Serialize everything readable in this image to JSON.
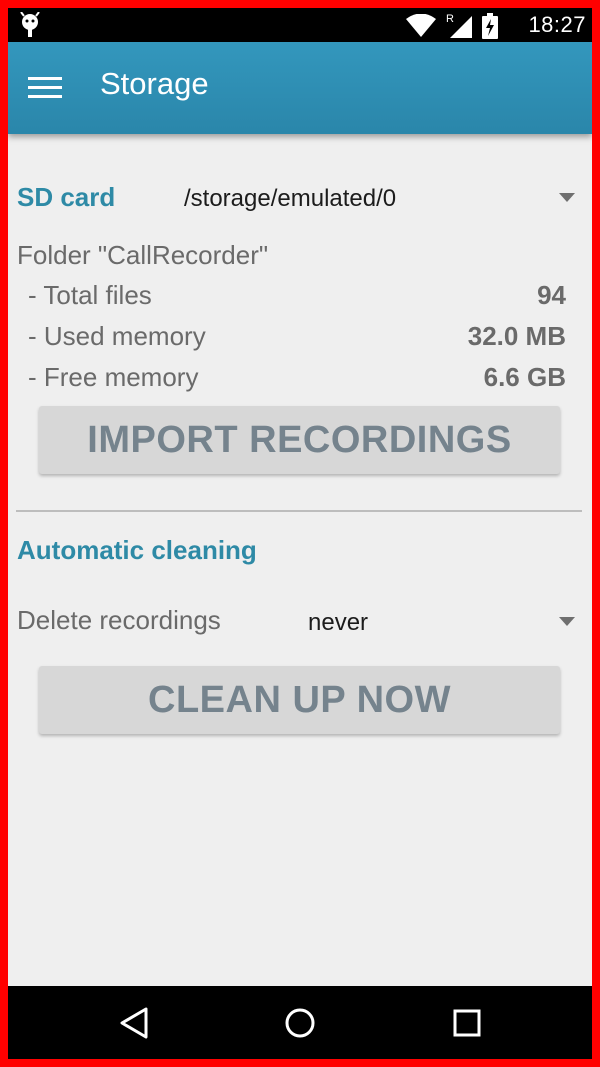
{
  "status_bar": {
    "time": "18:27",
    "left_icon": "android-debug-icon",
    "signal_roaming": "R"
  },
  "toolbar": {
    "title": "Storage",
    "menu_icon": "hamburger-menu-icon"
  },
  "storage": {
    "section_label": "SD card",
    "path_value": "/storage/emulated/0",
    "folder_label": "Folder \"CallRecorder\"",
    "stats": [
      {
        "label": " - Total files",
        "value": "94"
      },
      {
        "label": " - Used memory",
        "value": "32.0 MB"
      },
      {
        "label": " - Free memory",
        "value": "6.6 GB"
      }
    ],
    "import_button": "IMPORT RECORDINGS"
  },
  "cleaning": {
    "section_label": "Automatic cleaning",
    "delete_label": "Delete recordings",
    "delete_value": "never",
    "clean_button": "CLEAN UP NOW"
  },
  "colors": {
    "accent": "#2e8aa6",
    "toolbar": "#3397bd",
    "frame_border": "#ff0000",
    "background": "#efefef",
    "button_bg": "#d7d7d7",
    "button_text": "#75838d"
  },
  "nav_bar": {
    "back_icon": "back-triangle-icon",
    "home_icon": "home-circle-icon",
    "recents_icon": "recents-square-icon"
  }
}
